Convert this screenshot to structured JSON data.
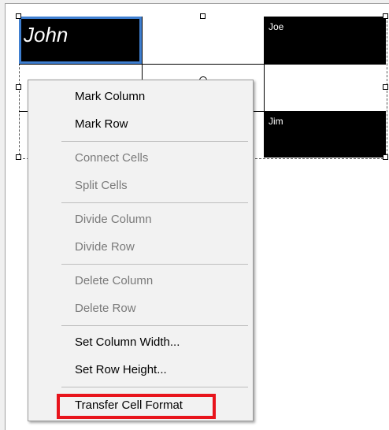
{
  "table": {
    "cells": {
      "john": "John",
      "joe": "Joe",
      "jim": "Jim"
    }
  },
  "context_menu": {
    "items": [
      {
        "label": "Mark Column",
        "enabled": true
      },
      {
        "label": "Mark Row",
        "enabled": true
      },
      {
        "label": "Connect Cells",
        "enabled": false
      },
      {
        "label": "Split Cells",
        "enabled": false
      },
      {
        "label": "Divide Column",
        "enabled": false
      },
      {
        "label": "Divide Row",
        "enabled": false
      },
      {
        "label": "Delete Column",
        "enabled": false
      },
      {
        "label": "Delete Row",
        "enabled": false
      },
      {
        "label": "Set Column Width...",
        "enabled": true
      },
      {
        "label": "Set Row Height...",
        "enabled": true
      },
      {
        "label": "Transfer Cell Format",
        "enabled": true,
        "highlighted": true
      }
    ],
    "highlight_color": "#e8141c"
  }
}
